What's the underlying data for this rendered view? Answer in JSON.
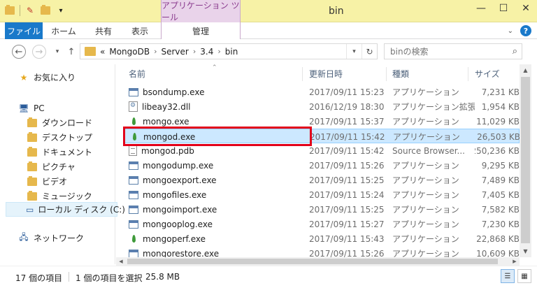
{
  "window": {
    "title": "bin",
    "context_tab": "アプリケーション ツール"
  },
  "ribbon": {
    "tabs": [
      "ファイル",
      "ホーム",
      "共有",
      "表示"
    ],
    "manage": "管理"
  },
  "address": {
    "overflow": "«",
    "breadcrumb": [
      "MongoDB",
      "Server",
      "3.4",
      "bin"
    ]
  },
  "search": {
    "placeholder": "binの検索"
  },
  "navpane": {
    "favorites": "お気に入り",
    "pc": "PC",
    "pc_items": [
      "ダウンロード",
      "デスクトップ",
      "ドキュメント",
      "ピクチャ",
      "ビデオ",
      "ミュージック"
    ],
    "local_disk": "ローカル ディスク (C:)",
    "network": "ネットワーク"
  },
  "columns": {
    "name": "名前",
    "date": "更新日時",
    "type": "種類",
    "size": "サイズ"
  },
  "files": [
    {
      "name": "bsondump.exe",
      "date": "2017/09/11 15:23",
      "type": "アプリケーション",
      "size": "7,231 KB",
      "icon": "exe"
    },
    {
      "name": "libeay32.dll",
      "date": "2016/12/19 18:30",
      "type": "アプリケーション拡張",
      "size": "1,954 KB",
      "icon": "dll"
    },
    {
      "name": "mongo.exe",
      "date": "2017/09/11 15:37",
      "type": "アプリケーション",
      "size": "11,029 KB",
      "icon": "leaf"
    },
    {
      "name": "mongod.exe",
      "date": "2017/09/11 15:42",
      "type": "アプリケーション",
      "size": "26,503 KB",
      "icon": "leaf"
    },
    {
      "name": "mongod.pdb",
      "date": "2017/09/11 15:42",
      "type": "Source Browser...",
      "size": "250,236 KB",
      "icon": "pdb"
    },
    {
      "name": "mongodump.exe",
      "date": "2017/09/11 15:26",
      "type": "アプリケーション",
      "size": "9,295 KB",
      "icon": "exe"
    },
    {
      "name": "mongoexport.exe",
      "date": "2017/09/11 15:25",
      "type": "アプリケーション",
      "size": "7,489 KB",
      "icon": "exe"
    },
    {
      "name": "mongofiles.exe",
      "date": "2017/09/11 15:24",
      "type": "アプリケーション",
      "size": "7,405 KB",
      "icon": "exe"
    },
    {
      "name": "mongoimport.exe",
      "date": "2017/09/11 15:25",
      "type": "アプリケーション",
      "size": "7,582 KB",
      "icon": "exe"
    },
    {
      "name": "mongooplog.exe",
      "date": "2017/09/11 15:27",
      "type": "アプリケーション",
      "size": "7,230 KB",
      "icon": "exe"
    },
    {
      "name": "mongoperf.exe",
      "date": "2017/09/11 15:43",
      "type": "アプリケーション",
      "size": "22,868 KB",
      "icon": "leaf"
    },
    {
      "name": "mongorestore.exe",
      "date": "2017/09/11 15:26",
      "type": "アプリケーション",
      "size": "10,609 KB",
      "icon": "exe"
    }
  ],
  "selected_file": "mongod.exe",
  "status": {
    "count": "17 個の項目",
    "selection": "1 個の項目を選択",
    "size": "25.8 MB"
  },
  "colors": {
    "title_bar": "#f7f2a6",
    "file_tab": "#1979ca",
    "context_tab": "#e9d3ea",
    "selection": "#cce8ff",
    "highlight": "#e2001a"
  }
}
